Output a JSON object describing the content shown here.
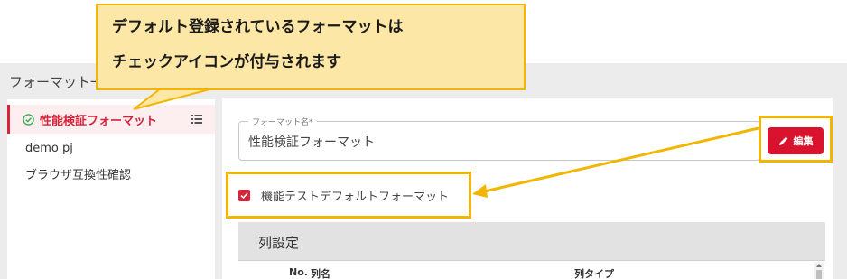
{
  "page": {
    "title": "フォーマット一"
  },
  "sidebar": {
    "items": [
      {
        "label": "性能検証フォーマット",
        "active": true,
        "icon": "check-circle-icon"
      },
      {
        "label": "demo pj",
        "active": false
      },
      {
        "label": "ブラウザ互換性確認",
        "active": false
      }
    ],
    "list_icon": "list-icon"
  },
  "format_field": {
    "label": "フォーマット名*",
    "value": "性能検証フォーマット"
  },
  "edit_button": {
    "label": "編集",
    "icon": "pencil-icon"
  },
  "default_checkbox": {
    "label": "機能テストデフォルトフォーマット",
    "checked": true
  },
  "column_section": {
    "title": "列設定",
    "headers": [
      "No.",
      "列名",
      "列タイプ"
    ]
  },
  "annotation": {
    "callout_lines": [
      "デフォルト登録されているフォーマットは",
      "チェックアイコンが付与されます"
    ]
  },
  "colors": {
    "accent": "#d6243b",
    "edit_button": "#d9132e",
    "callout_fill": "#fde7a6",
    "callout_border": "#f2b600"
  }
}
